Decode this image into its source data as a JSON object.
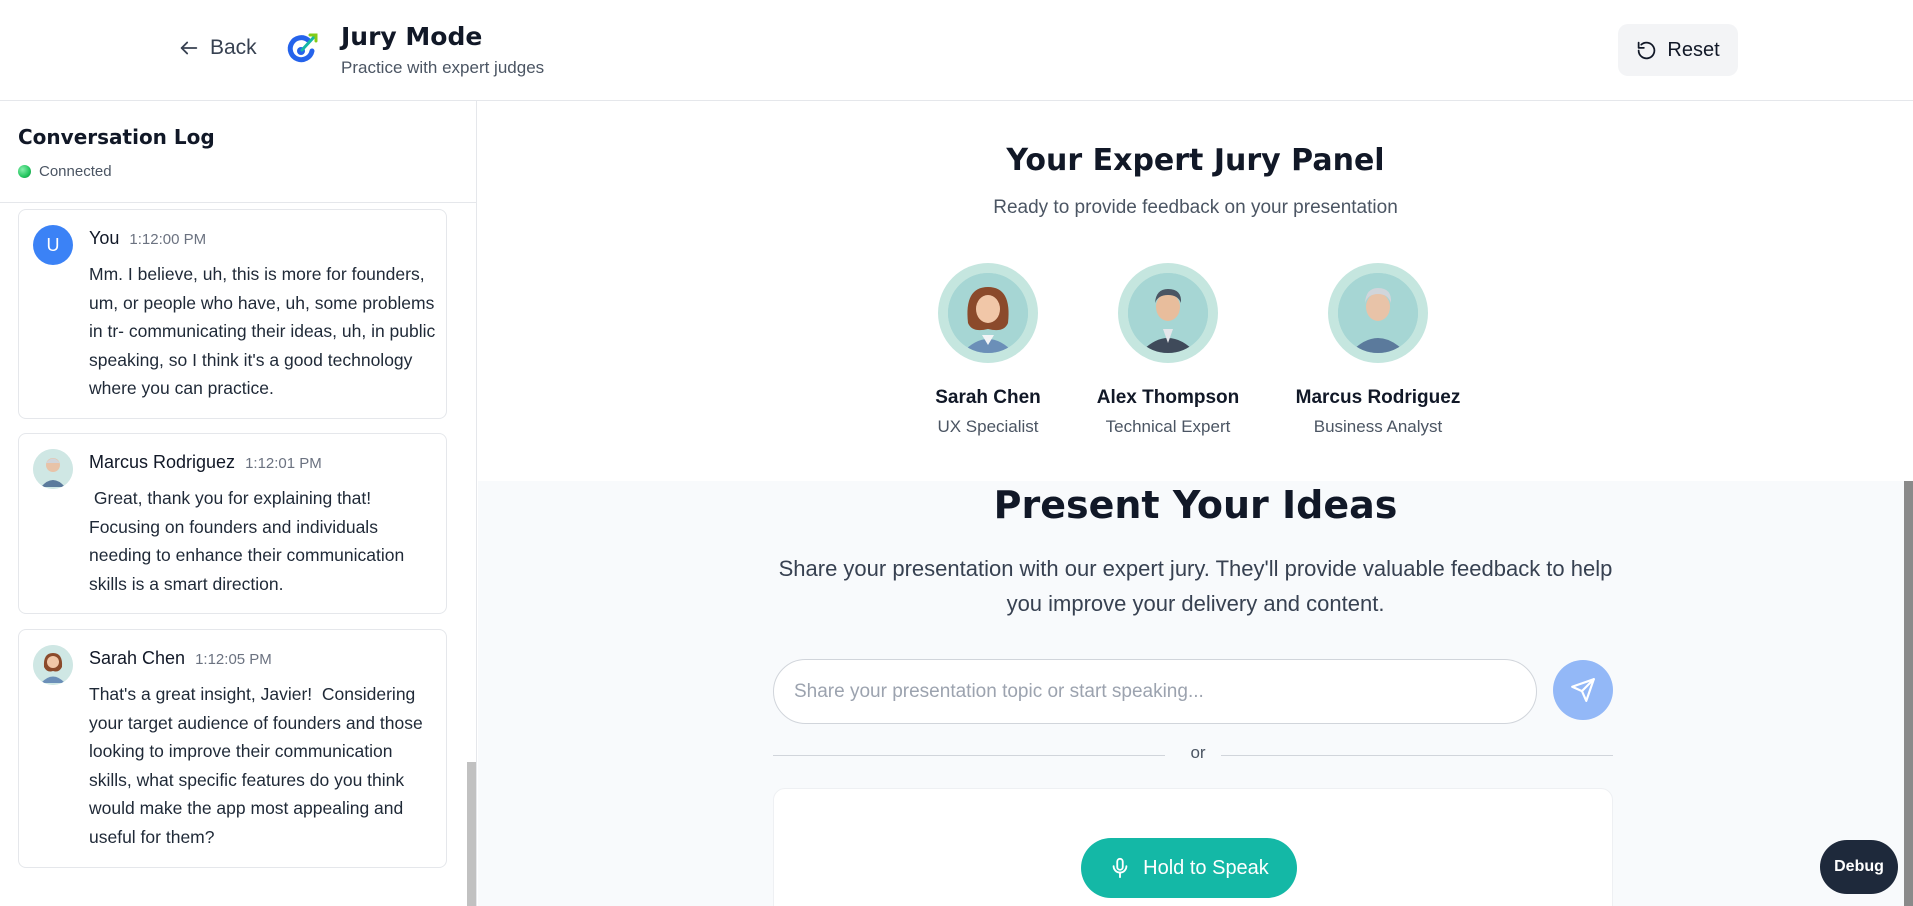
{
  "header": {
    "back_label": "Back",
    "title": "Jury Mode",
    "subtitle": "Practice with expert judges",
    "reset_label": "Reset"
  },
  "sidebar": {
    "title": "Conversation Log",
    "status": "Connected",
    "messages": [
      {
        "avatar": "U",
        "name": "You",
        "time": "1:12:00 PM",
        "text": "Mm. I believe, uh, this is more for founders, um, or people who have, uh, some problems in tr- communicating their ideas, uh, in public speaking, so I think it's a good technology where you can practice."
      },
      {
        "avatar": "marcus-portrait",
        "name": "Marcus Rodriguez",
        "time": "1:12:01 PM",
        "text": " Great, thank you for explaining that! Focusing on founders and individuals needing to enhance their communication skills is a smart direction."
      },
      {
        "avatar": "sarah-portrait",
        "name": "Sarah Chen",
        "time": "1:12:05 PM",
        "text": "That's a great insight, Javier!  Considering your target audience of founders and those looking to improve their communication skills, what specific features do you think would make the app most appealing and useful for them?"
      }
    ]
  },
  "jury": {
    "title": "Your Expert Jury Panel",
    "subtitle": "Ready to provide feedback on your presentation",
    "judges": [
      {
        "name": "Sarah Chen",
        "role": "UX Specialist"
      },
      {
        "name": "Alex Thompson",
        "role": "Technical Expert"
      },
      {
        "name": "Marcus Rodriguez",
        "role": "Business Analyst"
      }
    ]
  },
  "present": {
    "title": "Present Your Ideas",
    "description": "Share your presentation with our expert jury. They'll provide valuable feedback to help you improve your delivery and content.",
    "input_placeholder": "Share your presentation topic or start speaking...",
    "or_label": "or",
    "speak_label": "Hold to Speak"
  },
  "debug_label": "Debug",
  "colors": {
    "accent_teal": "#14b8a6",
    "send_blue": "#93b8f7",
    "user_avatar": "#3b82f6",
    "debug_bg": "#1e293b",
    "connected_green": "#22c55e"
  },
  "icons": [
    "arrow-left-icon",
    "logo-icon",
    "reset-icon",
    "send-icon",
    "microphone-icon",
    "status-dot-icon"
  ]
}
